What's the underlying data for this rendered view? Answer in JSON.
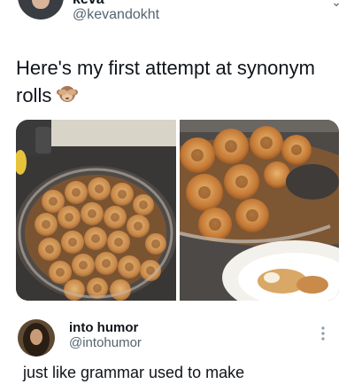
{
  "header": {
    "display_name": "keva",
    "handle": "@kevandokht"
  },
  "tweet": {
    "line1": "Here's my first attempt at synonym",
    "line2": "rolls",
    "emoji_icon": "see-no-evil-monkey-icon"
  },
  "media": {
    "left_image": "cinnamon-rolls-in-glass-dish",
    "right_image": "cinnamon-rolls-closeup-with-plate"
  },
  "reply": {
    "display_name": "into humor",
    "handle": "@intohumor",
    "text": "just like grammar used to make"
  },
  "colors": {
    "text": "#0f1419",
    "secondary": "#536471",
    "background": "#ffffff"
  }
}
